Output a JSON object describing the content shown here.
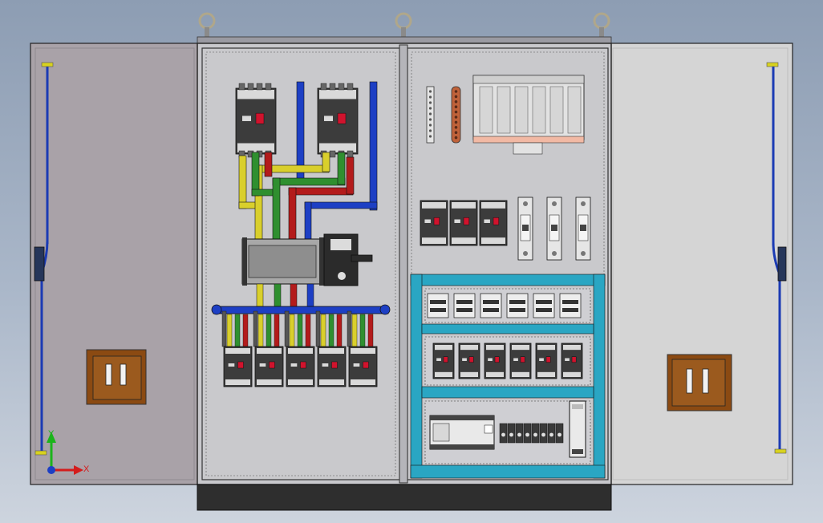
{
  "viewport": {
    "background_top": "#8d9db3",
    "background_bottom": "#cdd4de"
  },
  "cabinet": {
    "body_color": "#c8c8cc",
    "frame_color": "#2a2a2a",
    "plinth_color": "#2e2e2e",
    "left_door_color": "#a9a2a8",
    "right_door_color": "#d5d5d5",
    "door_rod_color": "#1b3bb4",
    "handle_color": "#8b4a12"
  },
  "busbars": {
    "phase_colors": [
      "#d9cf2c",
      "#2f8f2f",
      "#b31b1b",
      "#1d3fc4"
    ],
    "neutral_color": "#1d3fc4"
  },
  "accent_colors": {
    "rail_frame": "#2aa6c3",
    "breaker_body": "#3c3c3c",
    "breaker_indicator": "#d0132d"
  },
  "breakers": {
    "main_count": 2,
    "feeder_count": 5,
    "right_upper_count": 3,
    "fuse_holder_count": 3,
    "rail_row1_count": 6,
    "rail_row2_count": 6,
    "terminal_block_count": 8
  },
  "axis_triad": {
    "x_label": "X",
    "y_label": "Y",
    "x_color": "#d41c1c",
    "y_color": "#1bb41b",
    "z_color": "#1d3fc4"
  }
}
